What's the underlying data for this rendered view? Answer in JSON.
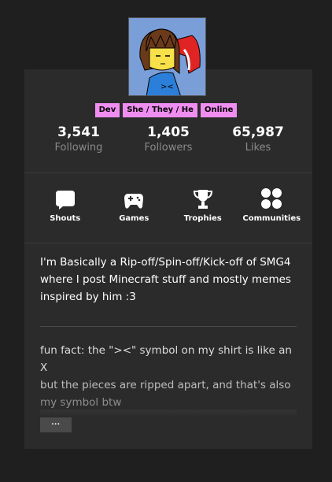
{
  "badges": [
    "Dev",
    "She / They / He",
    "Online"
  ],
  "stats": [
    {
      "value": "3,541",
      "label": "Following"
    },
    {
      "value": "1,405",
      "label": "Followers"
    },
    {
      "value": "65,987",
      "label": "Likes"
    }
  ],
  "nav": [
    {
      "label": "Shouts",
      "icon": "speech-bubble-icon"
    },
    {
      "label": "Games",
      "icon": "gamepad-icon"
    },
    {
      "label": "Trophies",
      "icon": "trophy-icon"
    },
    {
      "label": "Communities",
      "icon": "communities-icon"
    }
  ],
  "bio": {
    "text": "I'm Basically a Rip-off/Spin-off/Kick-off of SMG4 where I post Minecraft stuff and mostly memes inspired by him :3",
    "fact_line1": "fun fact: the \"><\" symbol on my shirt is like an X",
    "fact_line2": "but the pieces are ripped apart, and that's also",
    "fact_line3": "my symbol btw"
  },
  "more_label": "···",
  "colors": {
    "badge": "#f08df0",
    "card": "#2b2b2b",
    "background": "#1f1f1f"
  }
}
